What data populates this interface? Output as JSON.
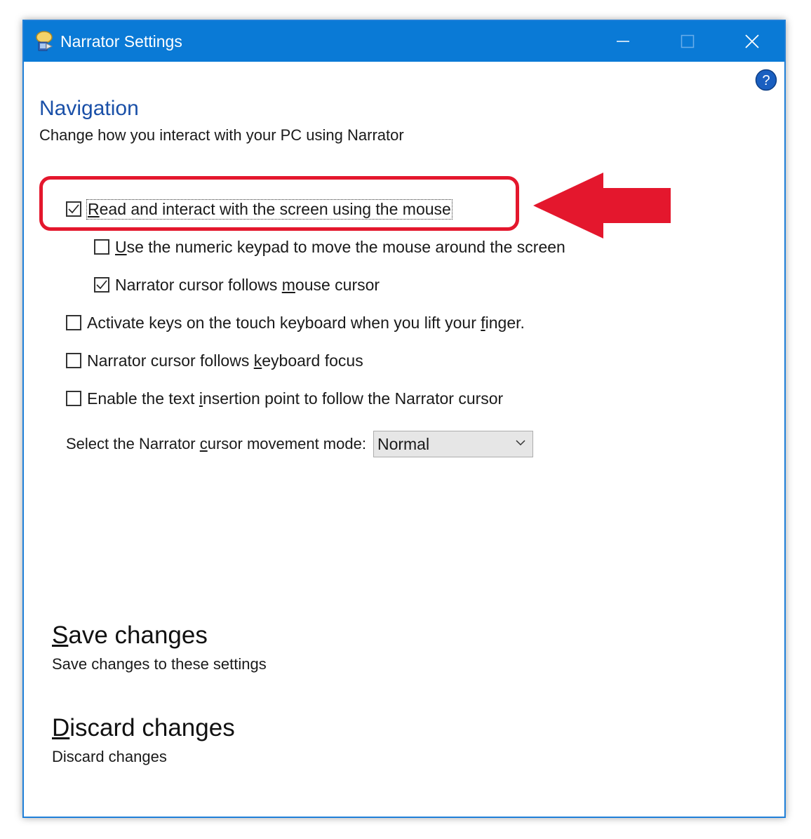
{
  "window": {
    "title": "Narrator Settings",
    "accent_color": "#0a7ad6"
  },
  "page": {
    "heading": "Navigation",
    "subtitle": "Change how you interact with your PC using Narrator"
  },
  "options": [
    {
      "pre": "",
      "key": "R",
      "post": "ead and interact with the screen using the mouse",
      "checked": true
    },
    {
      "pre": "",
      "key": "U",
      "post": "se the numeric keypad to move the mouse around the screen",
      "checked": false
    },
    {
      "pre": "Narrator cursor follows ",
      "key": "m",
      "post": "ouse cursor",
      "checked": true
    },
    {
      "pre": "Activate keys on the touch keyboard when you lift your ",
      "key": "f",
      "post": "inger.",
      "checked": false
    },
    {
      "pre": "Narrator cursor follows ",
      "key": "k",
      "post": "eyboard focus",
      "checked": false
    },
    {
      "pre": "Enable the text ",
      "key": "i",
      "post": "nsertion point to follow the Narrator cursor",
      "checked": false
    }
  ],
  "cursor_mode": {
    "label_pre": "Select the Narrator ",
    "label_key": "c",
    "label_post": "ursor movement mode:",
    "value": "Normal"
  },
  "save": {
    "title_key": "S",
    "title_rest": "ave changes",
    "description": "Save changes to these settings"
  },
  "discard": {
    "title_key": "D",
    "title_rest": "iscard changes",
    "description": "Discard changes"
  },
  "annotation_color": "#e4172d"
}
